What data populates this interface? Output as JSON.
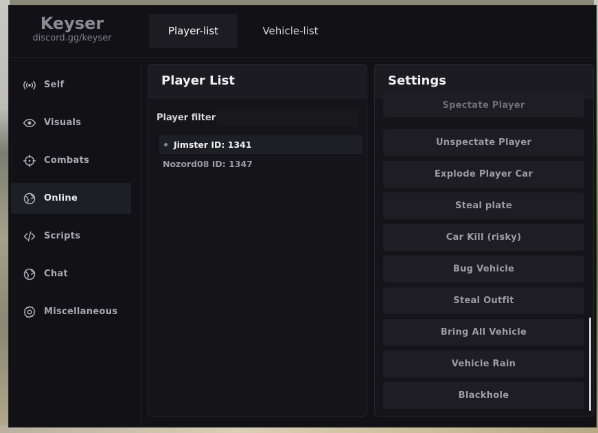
{
  "brand": {
    "title": "Keyser",
    "subtitle": "discord.gg/keyser"
  },
  "tabs": [
    {
      "label": "Player-list",
      "active": true
    },
    {
      "label": "Vehicle-list",
      "active": false
    }
  ],
  "sidebar": {
    "items": [
      {
        "label": "Self",
        "icon": "broadcast-icon"
      },
      {
        "label": "Visuals",
        "icon": "eye-icon"
      },
      {
        "label": "Combats",
        "icon": "crosshair-icon"
      },
      {
        "label": "Online",
        "icon": "globe-icon",
        "active": true
      },
      {
        "label": "Scripts",
        "icon": "code-icon"
      },
      {
        "label": "Chat",
        "icon": "globe-icon"
      },
      {
        "label": "Miscellaneous",
        "icon": "gear-icon"
      }
    ]
  },
  "player_panel": {
    "title": "Player List",
    "filter_label": "Player filter",
    "filter_value": "",
    "players": [
      {
        "label": "Jimster ID: 1341",
        "selected": true
      },
      {
        "label": "Nozord08 ID: 1347",
        "selected": false
      }
    ]
  },
  "settings_panel": {
    "title": "Settings",
    "actions": [
      "Spectate Player",
      "Unspectate Player",
      "Explode Player Car",
      "Steal plate",
      "Car Kill (risky)",
      "Bug Vehicle",
      "Steal Outfit",
      "Bring All Vehicle",
      "Vehicle Rain",
      "Blackhole"
    ]
  },
  "colors": {
    "window_bg": "#111116",
    "panel_bg": "#141419",
    "active_item_bg": "#1e1e25",
    "text_primary": "#f0f0f2",
    "text_muted": "#9c9ca2"
  }
}
